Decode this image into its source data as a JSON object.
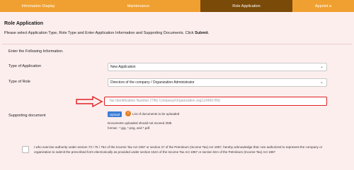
{
  "tabs": [
    {
      "label": "Information Display"
    },
    {
      "label": "Maintenance"
    },
    {
      "label": "Role Application"
    },
    {
      "label": "Appoint a"
    }
  ],
  "page": {
    "title": "Role Application",
    "instruction_prefix": "Please select Application Type, Role Type and Enter Application Information and Supporting Documents. Click ",
    "instruction_bold": "Submit",
    "instruction_suffix": "."
  },
  "form": {
    "enter_label": "Enter the Following Information.",
    "type_of_application_label": "Type of Application",
    "type_of_application_value": "New Application",
    "type_of_role_label": "Type of Role",
    "type_of_role_value": "Directors of the company / Organization Administrator",
    "tin_placeholder": "Tax Identification Number (TIN) Company/Organization (eg123456789)",
    "supporting_document_label": "Supporting document",
    "upload_label": "Upload",
    "list_documents_label": "List of documents to be uploaded",
    "note_line1": "Documents uploaded should not exceed 2Mb.",
    "note_line2": "format : *.jpg, *.png, and *.pdf.",
    "acknowledgement": "I who exercise authority under section 73 / 75 / 75A of the Income Tax Act 1967 or section 27 of the Petroleum (Income Tax) Act 1967, hereby acknowledge that I am authorized to represent the company or organization to submit the prescribed form electronically as provided under section 152A of the Income Tax Act 1967 or section 82A of the Petroleum (Income Tax) Act 1967"
  },
  "icons": {
    "chevron": "chevron-down-icon",
    "info": "info-icon",
    "annotation": "arrow-right-icon"
  },
  "colors": {
    "tab_bar": "#f0a030",
    "tab_active": "#7a4a08",
    "background": "#fdeeee",
    "highlight": "#e02020",
    "upload_button": "#3a7bd5",
    "info_icon": "#e67e22"
  }
}
